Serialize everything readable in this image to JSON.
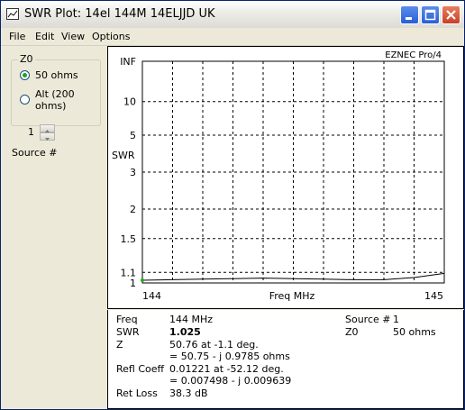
{
  "window": {
    "title": "SWR Plot: 14el 144M  14ELJJD UK"
  },
  "menu": [
    "File",
    "Edit",
    "View",
    "Options"
  ],
  "z0": {
    "group_label": "Z0",
    "options": [
      {
        "label": "50 ohms",
        "selected": true
      },
      {
        "label": "Alt (200\nohms)",
        "selected": false
      }
    ],
    "opt1": "50 ohms",
    "opt2_line1": "Alt (200",
    "opt2_line2": "ohms)"
  },
  "source": {
    "value": "1",
    "label": "Source #"
  },
  "plot": {
    "brand": "EZNEC Pro/4",
    "ylabel": "SWR",
    "xlabel": "Freq MHz",
    "x_start": "144",
    "x_end": "145"
  },
  "chart_data": {
    "type": "line",
    "title": "",
    "xlabel": "Freq MHz",
    "ylabel": "SWR",
    "x_ticks": [
      "144",
      "145"
    ],
    "y_ticks": [
      "INF",
      "10",
      "5",
      "3",
      "2",
      "1.5",
      "1.1",
      "1"
    ],
    "xlim": [
      144,
      145
    ],
    "grid": true,
    "series": [
      {
        "values": [
          {
            "x": 144.0,
            "y": 1.025
          },
          {
            "x": 144.1,
            "y": 1.03
          },
          {
            "x": 144.2,
            "y": 1.035
          },
          {
            "x": 144.3,
            "y": 1.04
          },
          {
            "x": 144.4,
            "y": 1.045
          },
          {
            "x": 144.5,
            "y": 1.04
          },
          {
            "x": 144.6,
            "y": 1.035
          },
          {
            "x": 144.7,
            "y": 1.03
          },
          {
            "x": 144.8,
            "y": 1.03
          },
          {
            "x": 144.9,
            "y": 1.05
          },
          {
            "x": 145.0,
            "y": 1.09
          }
        ]
      }
    ],
    "marker": {
      "x": 144.0,
      "y": 1.025
    }
  },
  "readout": {
    "freq_label": "Freq",
    "freq_value": "144 MHz",
    "swr_label": "SWR",
    "swr_value": "1.025",
    "z_label": "Z",
    "z_value1": "50.76 at -1.1 deg.",
    "z_value2": "= 50.75 - j 0.9785 ohms",
    "refl_label": "Refl Coeff",
    "refl_value1": "0.01221 at -52.12 deg.",
    "refl_value2": "= 0.007498 - j 0.009639",
    "retloss_label": "Ret Loss",
    "retloss_value": "38.3 dB",
    "source_label": "Source #",
    "source_value": "1",
    "z0_label": "Z0",
    "z0_value": "50 ohms"
  },
  "colors": {
    "curve": "#000000",
    "marker": "#22aa22",
    "titlebar_close": "#c8412a"
  }
}
